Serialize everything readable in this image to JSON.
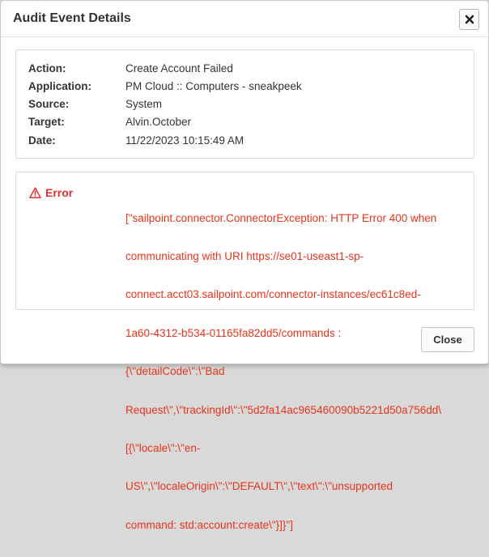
{
  "dialog": {
    "title": "Audit Event Details",
    "close_icon": "close-x-icon"
  },
  "details": [
    {
      "label": "Action:",
      "value": "Create Account Failed"
    },
    {
      "label": "Application:",
      "value": "PM Cloud :: Computers - sneakpeek"
    },
    {
      "label": "Source:",
      "value": "System"
    },
    {
      "label": "Target:",
      "value": "Alvin.October"
    },
    {
      "label": "Date:",
      "value": "11/22/2023 10:15:49 AM"
    }
  ],
  "error": {
    "icon": "warning-icon",
    "label": "Error",
    "lines": [
      "[\"sailpoint.connector.ConnectorException: HTTP Error 400 when",
      "communicating with URI https://se01-useast1-sp-",
      "connect.acct03.sailpoint.com/connector-instances/ec61c8ed-",
      "1a60-4312-b534-01165fa82dd5/commands :",
      "{\\\"detailCode\\\":\\\"Bad",
      "Request\\\",\\\"trackingId\\\":\\\"5d2fa14ac965460090b5221d50a756dd\\",
      "[{\\\"locale\\\":\\\"en-",
      "US\\\",\\\"localeOrigin\\\":\\\"DEFAULT\\\",\\\"text\\\":\\\"unsupported",
      "command: std:account:create\\\"}]}\"]"
    ],
    "color": "#e8341c"
  },
  "footer": {
    "close_label": "Close"
  }
}
